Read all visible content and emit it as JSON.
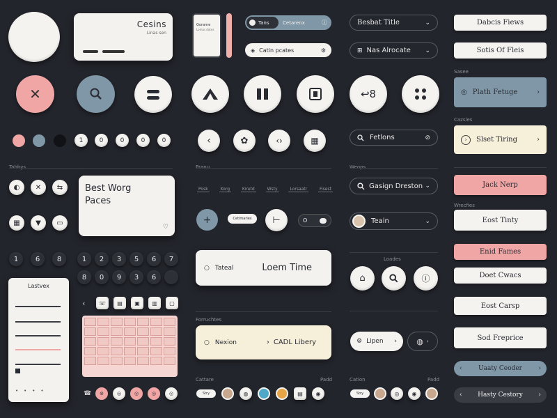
{
  "colors": {
    "background": "#23252c",
    "pink": "#f1a6a6",
    "blue_gray": "#7f97a6",
    "cream": "#f6efd9",
    "white": "#f4f3f0"
  },
  "top_card": {
    "title": "Cesins",
    "subtitle": "Linas sen"
  },
  "phone": {
    "title": "Gorarne",
    "subtitle": "Lomas dotes"
  },
  "toggle_pill": {
    "left": "Tans",
    "right": "Cetarenx"
  },
  "filter_pill": {
    "label": "Catin pcates"
  },
  "select_1": {
    "label": "Besbat Title"
  },
  "select_2": {
    "label": "Nas Alrocate"
  },
  "best_card": {
    "title": "Best Worg",
    "subtitle": "Paces"
  },
  "section_labels": {
    "tabs": "Tabbys",
    "tabs_mid": "Pranu",
    "inputs": "Weops",
    "loads": "Loades",
    "forms": "Forruchtes",
    "capture": "Cattare",
    "print": "Padd",
    "cation": "Cation",
    "paid": "Padd",
    "side_1": "Sasee",
    "side_2": "Cazsles",
    "side_3": "Wrecfies"
  },
  "tabs_row": [
    "Posk",
    "Korg",
    "Kiretd",
    "Wsty",
    "Lorsaatr",
    "Fisest"
  ],
  "search_input": {
    "label": "Fetlons"
  },
  "dropdown_search": {
    "label": "Gasign Dreston"
  },
  "avatar_select": {
    "label": "Teain"
  },
  "chip_small": {
    "label": "Cetimaries"
  },
  "toggle_small": {
    "label": "O"
  },
  "text_field_large": {
    "left": "Tateal",
    "right": "Loem Time"
  },
  "form_field": {
    "left": "Nexion",
    "right": "CADL Libery"
  },
  "pill_updown": {
    "label": "Lipen"
  },
  "keypad_numbers": [
    "1",
    "6",
    "8",
    "1",
    "2",
    "3",
    "5",
    "6",
    "7",
    "8",
    "0",
    "9",
    "3",
    "6"
  ],
  "panel": {
    "title": "Lastvex"
  },
  "side_buttons": {
    "b1": "Dabcis Fiews",
    "b2": "Sotis Of Fleis",
    "b3": "Plath Fetuge",
    "b4": "Slset Tiring",
    "b5": "Jack Nerp",
    "b6": "Eost Tinty",
    "b7": "Enid Fames",
    "b8": "Doet Cwacs",
    "b9": "Eost Carsp",
    "b10": "Sod Freprice",
    "b11": "Uaaty Ceoder",
    "b12": "Hasty Cestory"
  },
  "mini_row_1": [
    "1",
    "0",
    "0",
    "0",
    "0"
  ],
  "bottom_pill_left": {
    "label": "Stry"
  }
}
